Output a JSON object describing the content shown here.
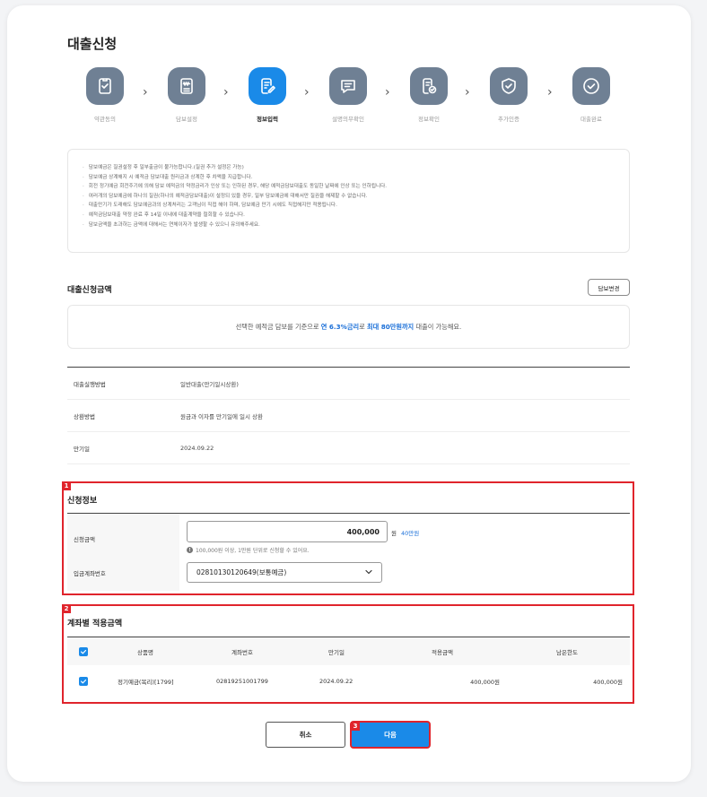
{
  "page": {
    "title": "대출신청"
  },
  "steps": [
    {
      "label": "약관동의",
      "icon": "checklist-icon",
      "active": false
    },
    {
      "label": "담보설정",
      "icon": "document-won-icon",
      "active": false
    },
    {
      "label": "정보입력",
      "icon": "edit-document-icon",
      "active": true
    },
    {
      "label": "설명의무확인",
      "icon": "chat-icon",
      "active": false
    },
    {
      "label": "정보확인",
      "icon": "document-check-icon",
      "active": false
    },
    {
      "label": "추가인증",
      "icon": "shield-check-icon",
      "active": false
    },
    {
      "label": "대출완료",
      "icon": "check-circle-icon",
      "active": false
    }
  ],
  "notice": [
    "담보예금은 질권설정 후 일부출금이 불가능합니다.(질권 추가 설정은 가능)",
    "담보예금 상계해지 시 예적금 담보대출 원리금과 상계한 후 차액을 지급합니다.",
    "회전 정기예금 회전주기에 의해 담보 예적금의 약정금리가 인상 또는 인하된 경우, 해당 예적금담보대출도 동일한 날짜에 인상 또는 인하됩니다.",
    "여러개의 담보예금에 하나의 질권(하나의 예적금담보대출)이 설정되 있을 경우, 일부 담보예금에 대해서만 질권을 해제할 수 없습니다.",
    "대출만기가 도래해도 담보예금과의 상계처리는 고객님이 직접 해야 하며, 담보예금 만기 시에도 직접해지만 적용됩니다.",
    "예적금담보대출 약정 완료 후 14일 이내에 대출계약을 철회할 수 있습니다.",
    "담보금액을 초과하는 금액에 대해서는 연체이자가 발생할 수 있으니 유의해주세요."
  ],
  "loan_amount": {
    "title": "대출신청금액",
    "change_button": "담보변경",
    "info_prefix": "선택한 예적금 담보를 기준으로",
    "info_rate": "연 6.3%금리",
    "info_mid": "로",
    "info_limit": "최대 80만원까지",
    "info_suffix": "대출이 가능해요."
  },
  "details": [
    {
      "key": "대출실행방법",
      "value": "일반대출(만기일시상환)"
    },
    {
      "key": "상환방법",
      "value": "원금과 이자를 만기일에 일시 상환"
    },
    {
      "key": "만기일",
      "value": "2024.09.22"
    }
  ],
  "application": {
    "tag": "1",
    "title": "신청정보",
    "amount_label": "신청금액",
    "amount_value": "400,000",
    "currency": "원",
    "max_link": "40만원",
    "hint": "100,000원 이상, 1만원 단위로 신청할 수 있어요.",
    "account_label": "입금계좌번호",
    "account_value": "02810130120649(보통예금)"
  },
  "accounts": {
    "tag": "2",
    "title": "계좌별 적용금액",
    "headers": [
      "상품명",
      "계좌번호",
      "만기일",
      "적용금액",
      "남은한도"
    ],
    "rows": [
      {
        "product": "정기예금(복리)[1799]",
        "account": "02819251001799",
        "maturity": "2024.09.22",
        "applied": "400,000원",
        "remaining": "400,000원"
      }
    ]
  },
  "buttons": {
    "cancel": "취소",
    "next": "다음",
    "next_tag": "3"
  },
  "colors": {
    "primary": "#1a8ae8",
    "step_inactive": "#6f8094",
    "highlight_red": "#e0242c",
    "link": "#1a6fd8"
  }
}
